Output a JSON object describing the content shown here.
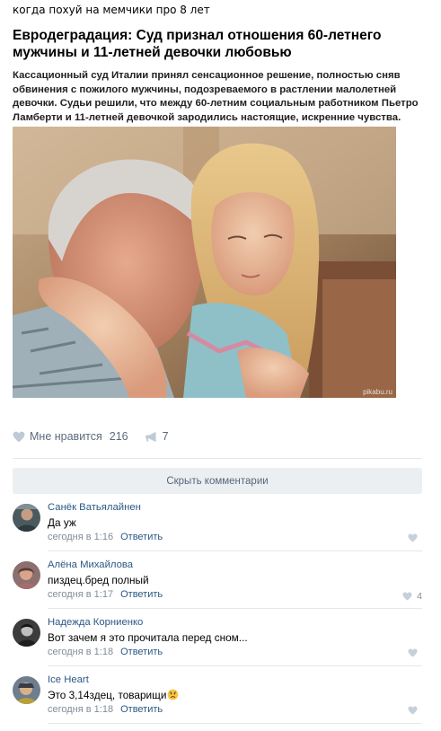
{
  "caption": "когда похуй на мемчики про 8 лет",
  "article": {
    "headline": "Евродеградация: Суд признал отношения 60-летнего мужчины и 11-летней девочки любовью",
    "lead": "Кассационный суд Италии принял сенсационное решение, полностью сняв обвинения с пожилого мужчины, подозреваемого в растлении малолетней девочки. Судьи решили, что между 60-летним социальным работником Пьетро Ламберти и 11-летней девочкой зародились настоящие, искренние чувства.",
    "watermark": "pikabu.ru"
  },
  "actions": {
    "like_label": "Мне нравится",
    "like_count": "216",
    "share_count": "7",
    "heart_icon": "heart-icon",
    "share_icon": "megaphone-icon",
    "icon_color": "#bfcad6"
  },
  "hide_comments_label": "Скрыть комментарии",
  "comments": [
    {
      "name": "Санёк Ватьялайнен",
      "text": "Да уж",
      "time": "сегодня в 1:16",
      "reply": "Ответить",
      "likes": ""
    },
    {
      "name": "Алёна Михайлова",
      "text": "пиздец.бред полный",
      "time": "сегодня в 1:17",
      "reply": "Ответить",
      "likes": "4"
    },
    {
      "name": "Надежда Корниенко",
      "text": "Вот зачем я это прочитала перед сном...",
      "time": "сегодня в 1:18",
      "reply": "Ответить",
      "likes": ""
    },
    {
      "name": "Ice Heart",
      "text": "Это 3,14здец, товарищи",
      "time": "сегодня в 1:18",
      "reply": "Ответить",
      "likes": ""
    }
  ],
  "colors": {
    "link": "#2a5885",
    "meta": "#828c98",
    "button_bg": "#eceff2"
  }
}
